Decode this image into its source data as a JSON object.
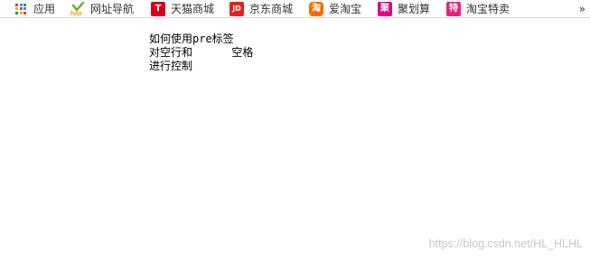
{
  "bookmarks_bar": {
    "items": [
      {
        "label": "应用",
        "icon": "apps-grid-icon"
      },
      {
        "label": "网址导航",
        "icon": "hao123-icon",
        "icon_text": "hao"
      },
      {
        "label": "天猫商城",
        "icon": "tmall-icon",
        "icon_text": "T"
      },
      {
        "label": "京东商城",
        "icon": "jd-icon",
        "icon_text": "JD"
      },
      {
        "label": "爱淘宝",
        "icon": "aitaobao-icon",
        "icon_text": "淘"
      },
      {
        "label": "聚划算",
        "icon": "juhuasuan-icon",
        "icon_text": "聚"
      },
      {
        "label": "淘宝特卖",
        "icon": "taobao-temai-icon",
        "icon_text": "特"
      }
    ],
    "overflow_label": "»"
  },
  "content": {
    "lines": [
      "如何使用pre标签",
      "对空行和      空格",
      "进行控制"
    ]
  },
  "watermark": "https://blog.csdn.net/HL_HLHL",
  "colors": {
    "apps": [
      "#db4437",
      "#4285f4",
      "#0f9d58",
      "#f4b400",
      "#db4437",
      "#4285f4",
      "#0f9d58",
      "#f4b400",
      "#db4437"
    ],
    "hao123": "#6ab023",
    "tmall": "#d5001c",
    "jd": "#e1251b",
    "aitaobao": "#ff6a00",
    "juhuasuan": "#e4007f",
    "taobao_temai": "#e4247a",
    "watermark": "#c8c8c8"
  }
}
